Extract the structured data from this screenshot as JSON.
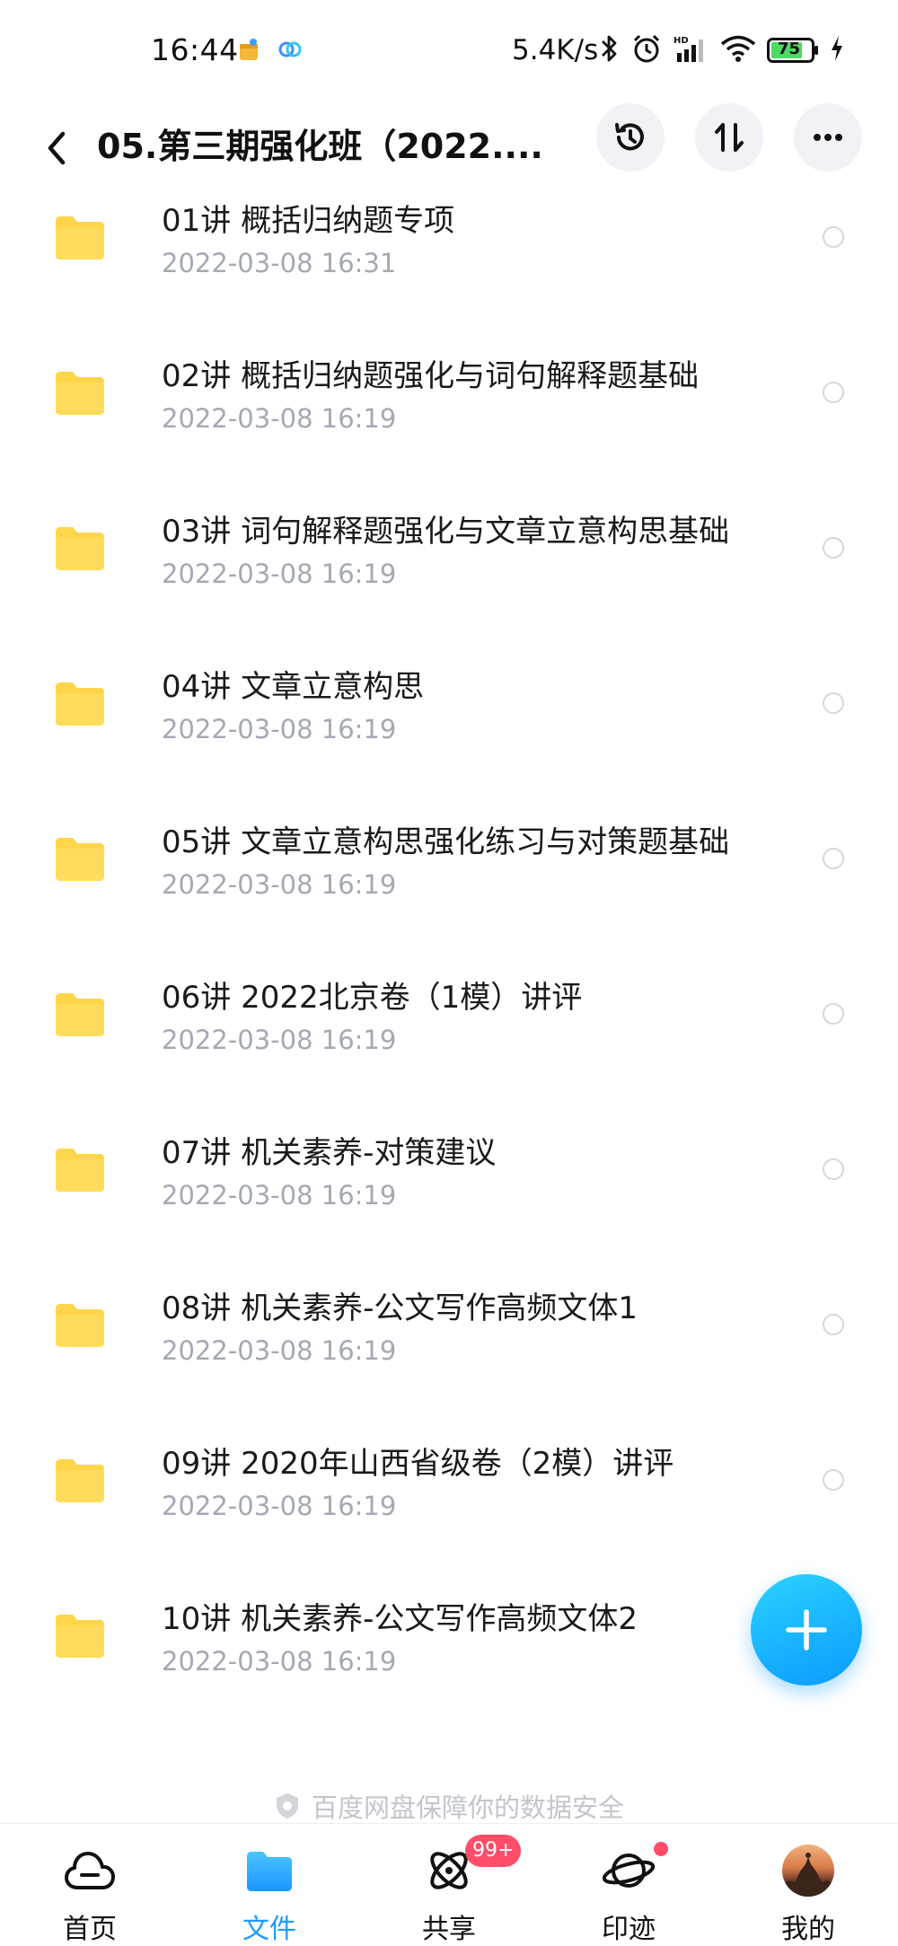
{
  "status_bar": {
    "time": "16:44",
    "speed": "5.4K/s",
    "battery": "75",
    "icons": [
      "app-notification-icon",
      "cloud-app-icon",
      "bluetooth-icon",
      "alarm-icon",
      "signal-icon",
      "wifi-icon",
      "battery-icon",
      "charging-icon"
    ]
  },
  "header": {
    "title": "05.第三期强化班（2022....",
    "actions": [
      "history-icon",
      "sort-icon",
      "more-icon"
    ]
  },
  "files": [
    {
      "name": "01讲 概括归纳题专项",
      "date": "2022-03-08  16:31"
    },
    {
      "name": "02讲 概括归纳题强化与词句解释题基础",
      "date": "2022-03-08  16:19"
    },
    {
      "name": "03讲 词句解释题强化与文章立意构思基础",
      "date": "2022-03-08  16:19"
    },
    {
      "name": "04讲 文章立意构思",
      "date": "2022-03-08  16:19"
    },
    {
      "name": "05讲 文章立意构思强化练习与对策题基础",
      "date": "2022-03-08  16:19"
    },
    {
      "name": "06讲 2022北京卷（1模）讲评",
      "date": "2022-03-08  16:19"
    },
    {
      "name": "07讲 机关素养-对策建议",
      "date": "2022-03-08  16:19"
    },
    {
      "name": "08讲 机关素养-公文写作高频文体1",
      "date": "2022-03-08  16:19"
    },
    {
      "name": "09讲 2020年山西省级卷（2模）讲评",
      "date": "2022-03-08  16:19"
    },
    {
      "name": "10讲 机关素养-公文写作高频文体2",
      "date": "2022-03-08  16:19"
    }
  ],
  "safety_text": "百度网盘保障你的数据安全",
  "nav": [
    {
      "label": "首页",
      "icon": "cloud-home-icon",
      "active": false
    },
    {
      "label": "文件",
      "icon": "folder-icon",
      "active": true
    },
    {
      "label": "共享",
      "icon": "share-orbit-icon",
      "active": false,
      "badge": "99+"
    },
    {
      "label": "印迹",
      "icon": "planet-icon",
      "active": false,
      "dot": true
    },
    {
      "label": "我的",
      "icon": "avatar",
      "active": false
    }
  ],
  "colors": {
    "accent": "#1e9bff",
    "folder": "#ffd54a",
    "date_text": "#a4a9b4",
    "badge": "#ff4d6a"
  }
}
